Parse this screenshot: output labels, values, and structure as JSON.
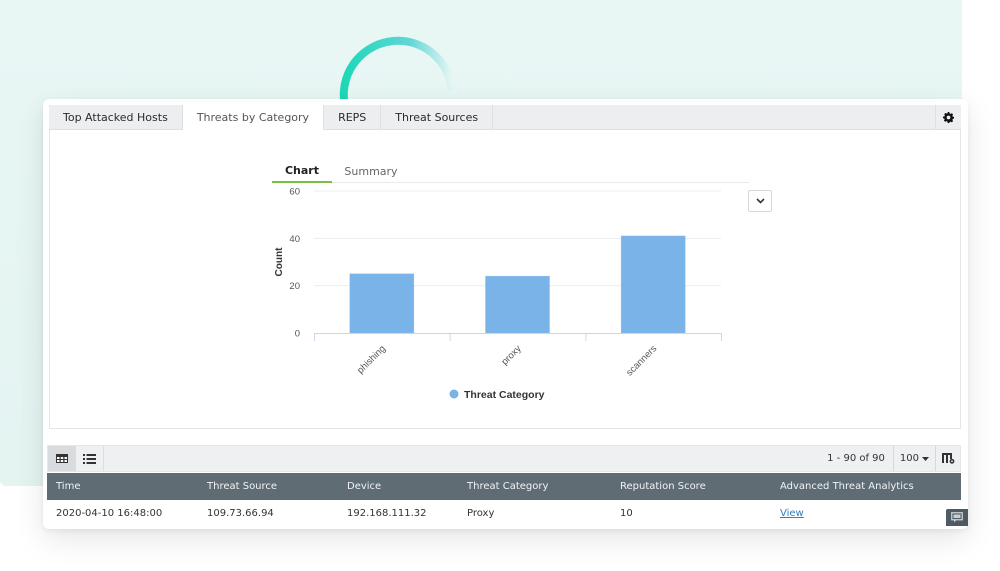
{
  "tabs": [
    {
      "label": "Top Attacked Hosts",
      "active": false
    },
    {
      "label": "Threats by Category",
      "active": true
    },
    {
      "label": "REPS",
      "active": false
    },
    {
      "label": "Threat Sources",
      "active": false
    }
  ],
  "icons": {
    "settings": "gear-icon",
    "dropdown": "chevron-down-icon",
    "grid_view": "table-grid-icon",
    "list_view": "list-icon",
    "page_size_caret": "caret-down-icon",
    "column_settings": "column-settings-icon",
    "chat": "chat-icon"
  },
  "subtabs": [
    {
      "label": "Chart",
      "active": true
    },
    {
      "label": "Summary",
      "active": false
    }
  ],
  "colors": {
    "accent_green": "#7cbf3c",
    "bar_blue": "#7ab3e8",
    "table_header": "#5f6c74",
    "link": "#2d7fc1",
    "decor_teal": "#1dd8b8"
  },
  "chart_data": {
    "type": "bar",
    "title": "",
    "xlabel": "",
    "ylabel": "Count",
    "categories": [
      "phishing",
      "proxy",
      "scanners"
    ],
    "series": [
      {
        "name": "Threat Category",
        "values": [
          25,
          24,
          41
        ]
      }
    ],
    "ylim": [
      0,
      60
    ],
    "yticks": [
      0,
      20,
      40,
      60
    ],
    "grid": true,
    "legend": "bottom-center"
  },
  "pager": {
    "range_text": "1 - 90 of 90",
    "page_size": "100"
  },
  "table": {
    "columns": [
      "Time",
      "Threat Source",
      "Device",
      "Threat Category",
      "Reputation Score",
      "Advanced Threat Analytics"
    ],
    "rows": [
      {
        "time": "2020-04-10 16:48:00",
        "threat_source": "109.73.66.94",
        "device": "192.168.111.32",
        "threat_category": "Proxy",
        "reputation_score": "10",
        "analytics_link": "View"
      }
    ]
  }
}
